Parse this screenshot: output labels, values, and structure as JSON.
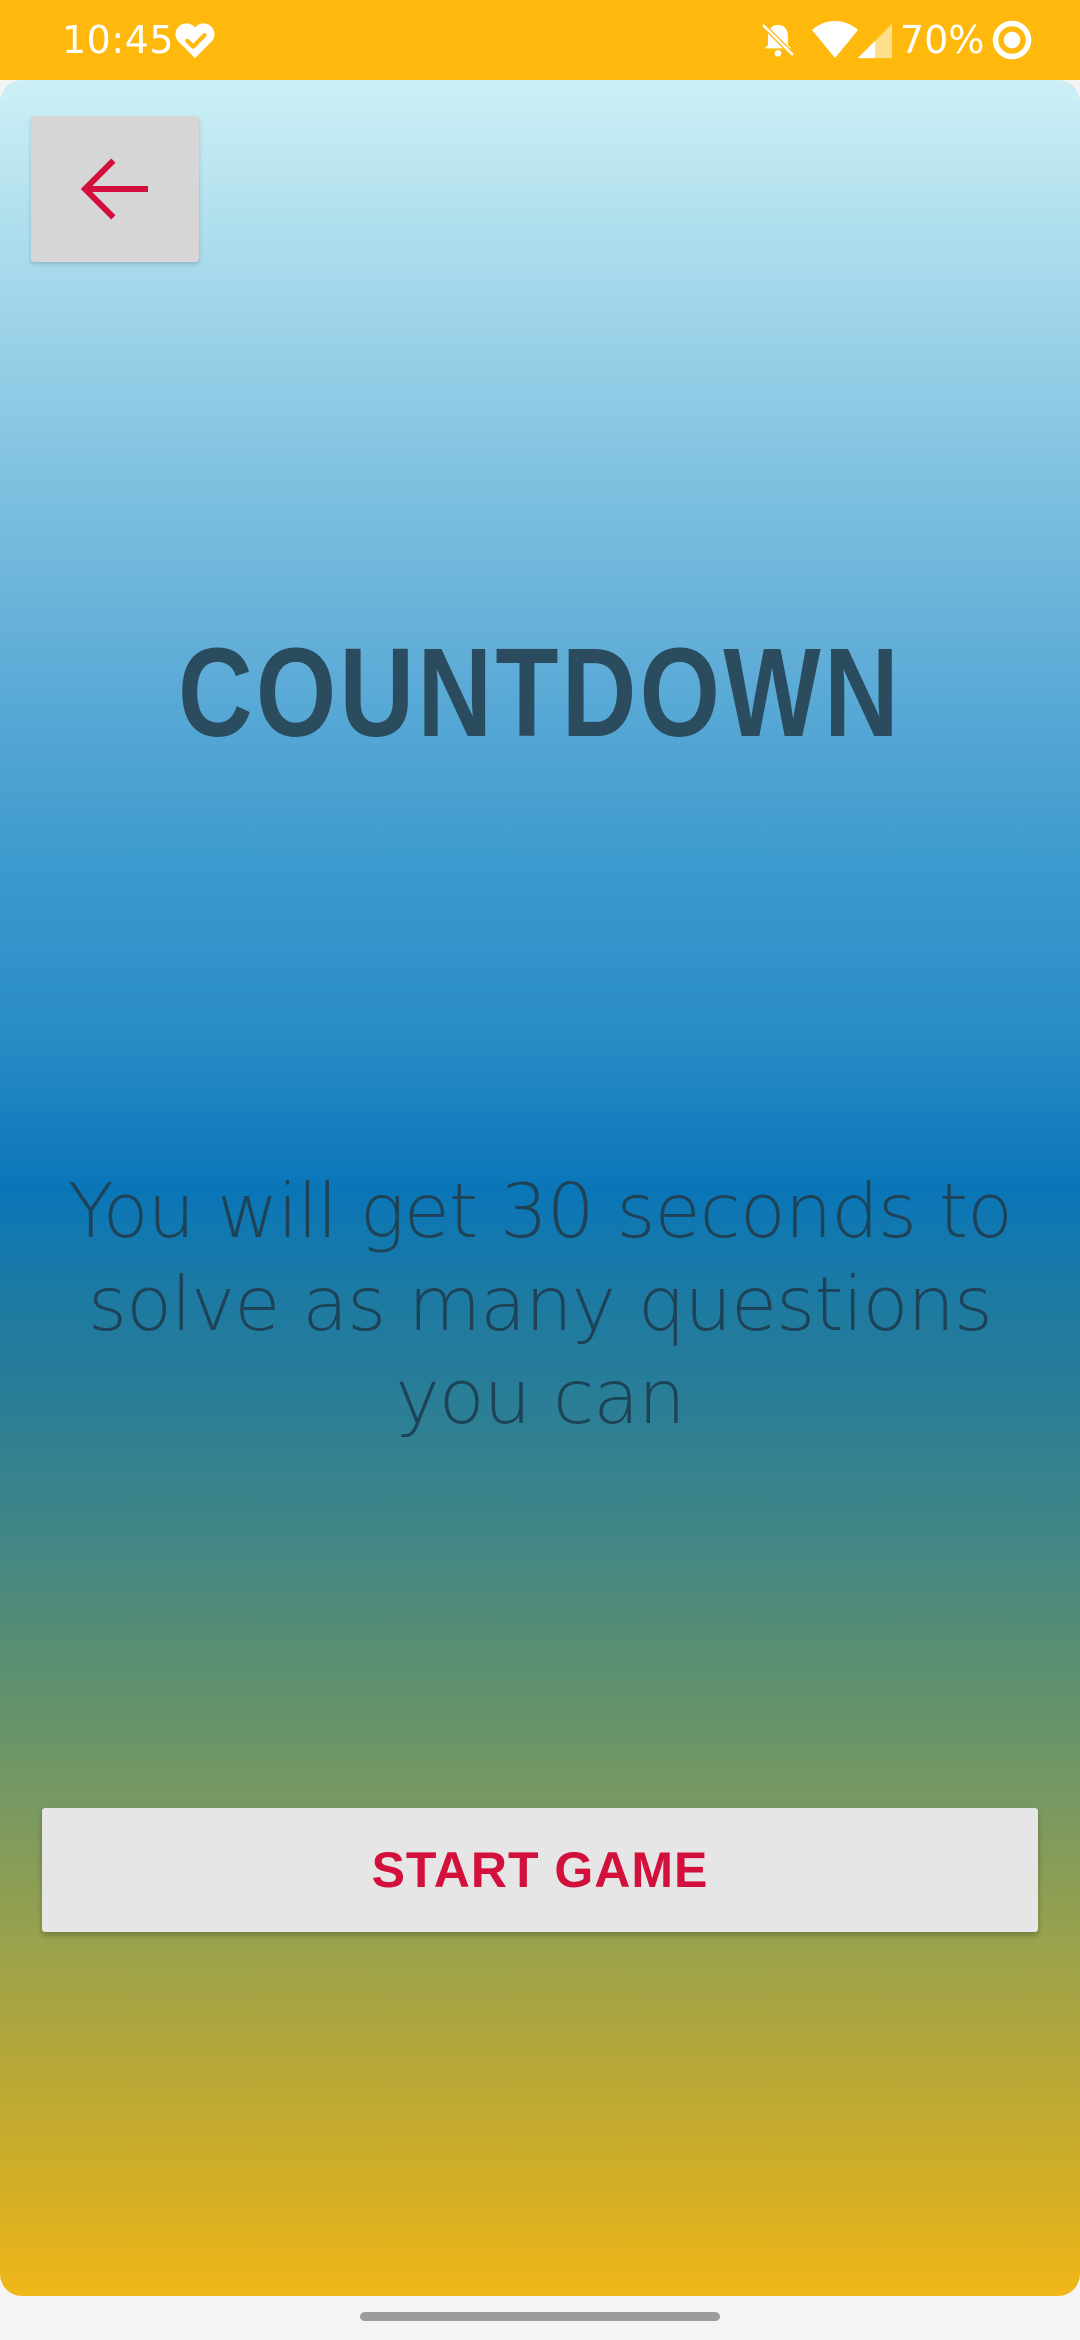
{
  "status_bar": {
    "time": "10:45",
    "battery": "70%",
    "icons": [
      "heart-check-icon",
      "bell-off-icon",
      "wifi-icon",
      "signal-icon",
      "battery-saver-icon"
    ],
    "background_color": "#ffb90c"
  },
  "header": {
    "back_icon": "back-arrow-icon",
    "back_icon_color": "#d30f3c"
  },
  "main": {
    "title": "COUNTDOWN",
    "description": "You will get 30 seconds to solve as many questions you can",
    "start_button_label": "START GAME"
  },
  "colors": {
    "accent": "#d30f3c",
    "title_text": "#2b4c5f",
    "gradient_top": "#cdf0f6",
    "gradient_middle": "#0a76b8",
    "gradient_bottom": "#f0b618"
  }
}
